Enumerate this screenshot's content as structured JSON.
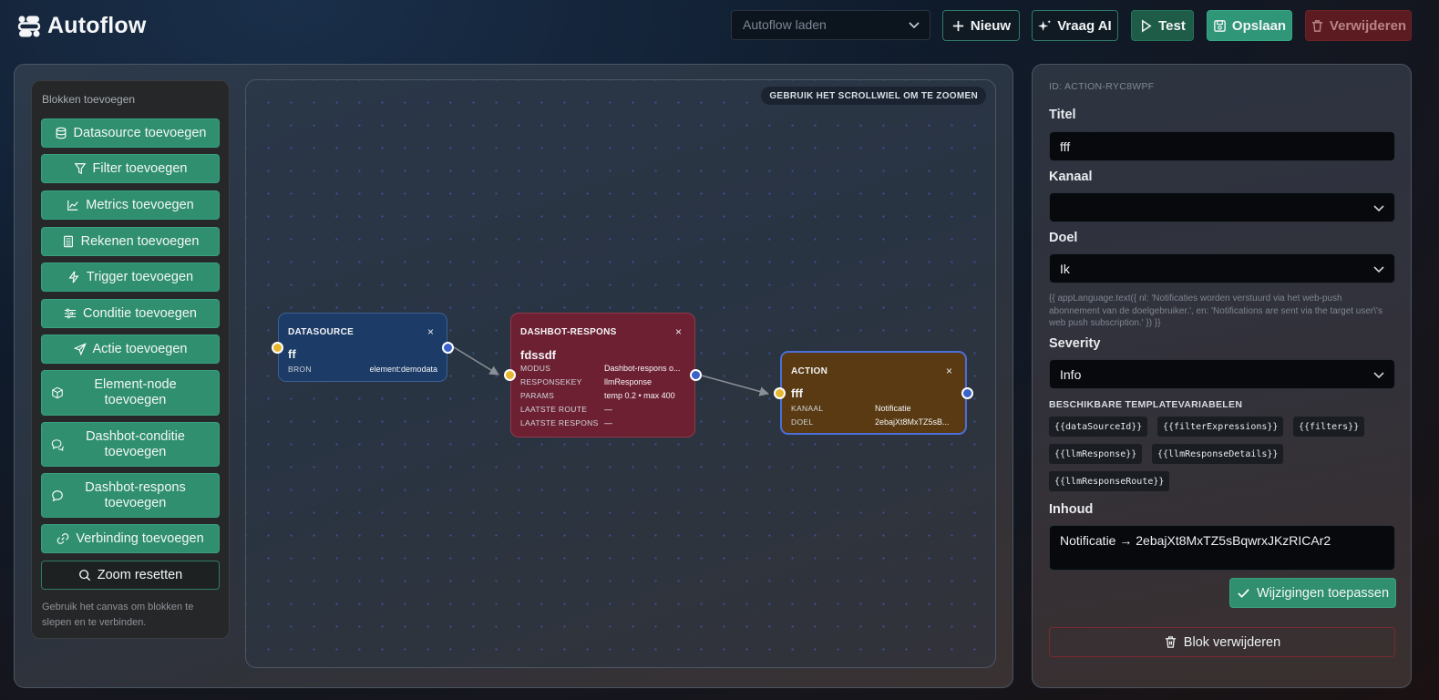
{
  "header": {
    "app_title": "Autoflow",
    "load_placeholder": "Autoflow laden",
    "new_label": "Nieuw",
    "ask_ai_label": "Vraag AI",
    "test_label": "Test",
    "save_label": "Opslaan",
    "delete_label": "Verwijderen"
  },
  "sidebar": {
    "title": "Blokken toevoegen",
    "items": [
      {
        "label": "Datasource toevoegen",
        "icon": "database-icon"
      },
      {
        "label": "Filter toevoegen",
        "icon": "filter-icon"
      },
      {
        "label": "Metrics toevoegen",
        "icon": "chart-line-icon"
      },
      {
        "label": "Rekenen toevoegen",
        "icon": "calculator-icon"
      },
      {
        "label": "Trigger toevoegen",
        "icon": "lightning-icon"
      },
      {
        "label": "Conditie toevoegen",
        "icon": "sliders-icon"
      },
      {
        "label": "Actie toevoegen",
        "icon": "send-icon"
      },
      {
        "label": "Element-node toevoegen",
        "icon": "cube-icon"
      },
      {
        "label": "Dashbot-conditie toevoegen",
        "icon": "chat-bubbles-icon"
      },
      {
        "label": "Dashbot-respons toevoegen",
        "icon": "chat-bubble-icon"
      },
      {
        "label": "Verbinding toevoegen",
        "icon": "link-icon"
      }
    ],
    "zoom_reset_label": "Zoom resetten",
    "hint": "Gebruik het canvas om blokken te slepen en te verbinden."
  },
  "canvas": {
    "zoom_hint": "GEBRUIK HET SCROLLWIEL OM TE ZOOMEN",
    "nodes": {
      "datasource": {
        "type": "DATASOURCE",
        "title": "ff",
        "rows": [
          {
            "key": "BRON",
            "value": "element:demodata"
          }
        ]
      },
      "dashbot": {
        "type": "DASHBOT-RESPONS",
        "title": "fdssdf",
        "rows": [
          {
            "key": "MODUS",
            "value": "Dashbot-respons o..."
          },
          {
            "key": "RESPONSEKEY",
            "value": "llmResponse"
          },
          {
            "key": "PARAMS",
            "value": "temp 0.2 • max 400"
          },
          {
            "key": "LAATSTE ROUTE",
            "value": "—"
          },
          {
            "key": "LAATSTE RESPONS",
            "value": "—"
          }
        ]
      },
      "action": {
        "type": "ACTION",
        "title": "fff",
        "rows": [
          {
            "key": "KANAAL",
            "value": "Notificatie"
          },
          {
            "key": "DOEL",
            "value": "2ebajXt8MxTZ5sB..."
          }
        ]
      }
    },
    "close_glyph": "×"
  },
  "inspector": {
    "id_label": "ID: ACTION-RYC8WPF",
    "titel_label": "Titel",
    "titel_value": "fff",
    "kanaal_label": "Kanaal",
    "kanaal_value": "",
    "doel_label": "Doel",
    "doel_value": "Ik",
    "help_text": "{{ appLanguage.text({ nl: 'Notificaties worden verstuurd via het web-push abonnement van de doelgebruiker.', en: 'Notifications are sent via the target user\\'s web push subscription.' }) }}",
    "severity_label": "Severity",
    "severity_value": "Info",
    "template_vars_title": "BESCHIKBARE TEMPLATEVARIABELEN",
    "template_vars": [
      "{{dataSourceId}}",
      "{{filterExpressions}}",
      "{{filters}}",
      "{{llmResponse}}",
      "{{llmResponseDetails}}",
      "{{llmResponseRoute}}"
    ],
    "inhoud_label": "Inhoud",
    "inhoud_value": "Notificatie → 2ebajXt8MxTZ5sBqwrxJKzRICAr2",
    "apply_label": "Wijzigingen toepassen",
    "delete_block_label": "Blok verwijderen"
  },
  "colors": {
    "accent_green": "#2f8f6f",
    "danger_red": "#5b1b20",
    "datasource_node": "#1c3b66",
    "dashbot_node": "#6e2033",
    "action_node": "#5a3a12",
    "port_in": "#e7b731",
    "port_out": "#3a62c9"
  }
}
